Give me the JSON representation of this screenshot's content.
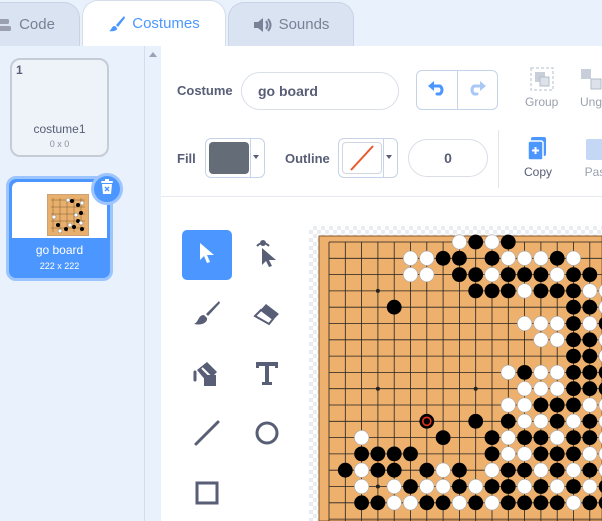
{
  "tabs": [
    {
      "label": "Code",
      "icon": "code-blocks-icon"
    },
    {
      "label": "Costumes",
      "icon": "paintbrush-icon",
      "active": true
    },
    {
      "label": "Sounds",
      "icon": "speaker-icon"
    }
  ],
  "costumes": [
    {
      "number": "1",
      "name": "costume1",
      "size": "0 x 0"
    },
    {
      "number": "2",
      "name": "go board",
      "size": "222 x 222",
      "selected": true
    }
  ],
  "editor": {
    "costume_label": "Costume",
    "costume_name": "go board",
    "group_label": "Group",
    "ungroup_label": "Ung",
    "copy_label": "Copy",
    "paste_label": "Pas",
    "fill_label": "Fill",
    "fill_color": "#646c78",
    "outline_label": "Outline",
    "outline_width": "0"
  },
  "tools": [
    "select-tool",
    "reshape-tool",
    "brush-tool",
    "eraser-tool",
    "fill-tool",
    "text-tool",
    "line-tool",
    "circle-tool",
    "rectangle-tool"
  ],
  "colors": {
    "accent": "#4c97ff",
    "board": "#eeb06d",
    "panel": "#e9f1fc"
  },
  "board": {
    "size": 19,
    "last_move": [
      11,
      6
    ],
    "black": [
      [
        0,
        9
      ],
      [
        0,
        11
      ],
      [
        1,
        7
      ],
      [
        1,
        8
      ],
      [
        1,
        10
      ],
      [
        1,
        14
      ],
      [
        2,
        8
      ],
      [
        2,
        9
      ],
      [
        2,
        11
      ],
      [
        2,
        12
      ],
      [
        2,
        13
      ],
      [
        2,
        15
      ],
      [
        2,
        16
      ],
      [
        3,
        9
      ],
      [
        3,
        10
      ],
      [
        3,
        11
      ],
      [
        3,
        13
      ],
      [
        3,
        14
      ],
      [
        3,
        15
      ],
      [
        4,
        4
      ],
      [
        4,
        15
      ],
      [
        4,
        16
      ],
      [
        5,
        15
      ],
      [
        5,
        17
      ],
      [
        5,
        18
      ],
      [
        6,
        15
      ],
      [
        6,
        16
      ],
      [
        6,
        18
      ],
      [
        7,
        15
      ],
      [
        7,
        16
      ],
      [
        7,
        17
      ],
      [
        8,
        12
      ],
      [
        8,
        15
      ],
      [
        8,
        16
      ],
      [
        8,
        17
      ],
      [
        9,
        15
      ],
      [
        9,
        16
      ],
      [
        9,
        17
      ],
      [
        10,
        13
      ],
      [
        10,
        14
      ],
      [
        10,
        15
      ],
      [
        11,
        9
      ],
      [
        11,
        11
      ],
      [
        11,
        14
      ],
      [
        11,
        16
      ],
      [
        12,
        7
      ],
      [
        12,
        10
      ],
      [
        12,
        12
      ],
      [
        12,
        13
      ],
      [
        12,
        15
      ],
      [
        12,
        16
      ],
      [
        13,
        2
      ],
      [
        13,
        3
      ],
      [
        13,
        4
      ],
      [
        13,
        5
      ],
      [
        13,
        10
      ],
      [
        13,
        13
      ],
      [
        13,
        14
      ],
      [
        13,
        15
      ],
      [
        14,
        1
      ],
      [
        14,
        3
      ],
      [
        14,
        4
      ],
      [
        14,
        6
      ],
      [
        14,
        8
      ],
      [
        14,
        11
      ],
      [
        14,
        12
      ],
      [
        14,
        14
      ],
      [
        14,
        16
      ],
      [
        15,
        5
      ],
      [
        15,
        8
      ],
      [
        15,
        10
      ],
      [
        15,
        11
      ],
      [
        15,
        13
      ],
      [
        15,
        15
      ],
      [
        15,
        17
      ],
      [
        16,
        2
      ],
      [
        16,
        3
      ],
      [
        16,
        6
      ],
      [
        16,
        7
      ],
      [
        16,
        9
      ],
      [
        16,
        11
      ],
      [
        16,
        12
      ],
      [
        16,
        13
      ],
      [
        16,
        14
      ],
      [
        16,
        16
      ],
      [
        16,
        17
      ]
    ],
    "white": [
      [
        0,
        8
      ],
      [
        0,
        10
      ],
      [
        1,
        5
      ],
      [
        1,
        6
      ],
      [
        1,
        11
      ],
      [
        1,
        12
      ],
      [
        1,
        13
      ],
      [
        1,
        15
      ],
      [
        2,
        5
      ],
      [
        2,
        6
      ],
      [
        2,
        10
      ],
      [
        2,
        14
      ],
      [
        3,
        12
      ],
      [
        3,
        16
      ],
      [
        3,
        17
      ],
      [
        4,
        17
      ],
      [
        5,
        12
      ],
      [
        5,
        13
      ],
      [
        5,
        14
      ],
      [
        5,
        16
      ],
      [
        6,
        13
      ],
      [
        6,
        14
      ],
      [
        6,
        17
      ],
      [
        7,
        17
      ],
      [
        7,
        18
      ],
      [
        8,
        11
      ],
      [
        8,
        13
      ],
      [
        8,
        14
      ],
      [
        8,
        18
      ],
      [
        9,
        12
      ],
      [
        9,
        13
      ],
      [
        9,
        14
      ],
      [
        9,
        18
      ],
      [
        10,
        11
      ],
      [
        10,
        12
      ],
      [
        10,
        16
      ],
      [
        10,
        17
      ],
      [
        11,
        12
      ],
      [
        11,
        13
      ],
      [
        11,
        15
      ],
      [
        11,
        17
      ],
      [
        12,
        2
      ],
      [
        12,
        11
      ],
      [
        12,
        14
      ],
      [
        12,
        17
      ],
      [
        13,
        11
      ],
      [
        13,
        12
      ],
      [
        13,
        16
      ],
      [
        13,
        17
      ],
      [
        14,
        2
      ],
      [
        14,
        7
      ],
      [
        14,
        10
      ],
      [
        14,
        13
      ],
      [
        14,
        15
      ],
      [
        14,
        17
      ],
      [
        15,
        2
      ],
      [
        15,
        4
      ],
      [
        15,
        6
      ],
      [
        15,
        7
      ],
      [
        15,
        9
      ],
      [
        15,
        12
      ],
      [
        15,
        14
      ],
      [
        15,
        16
      ],
      [
        16,
        4
      ],
      [
        16,
        5
      ],
      [
        16,
        8
      ],
      [
        16,
        10
      ],
      [
        16,
        15
      ],
      [
        16,
        18
      ]
    ]
  }
}
